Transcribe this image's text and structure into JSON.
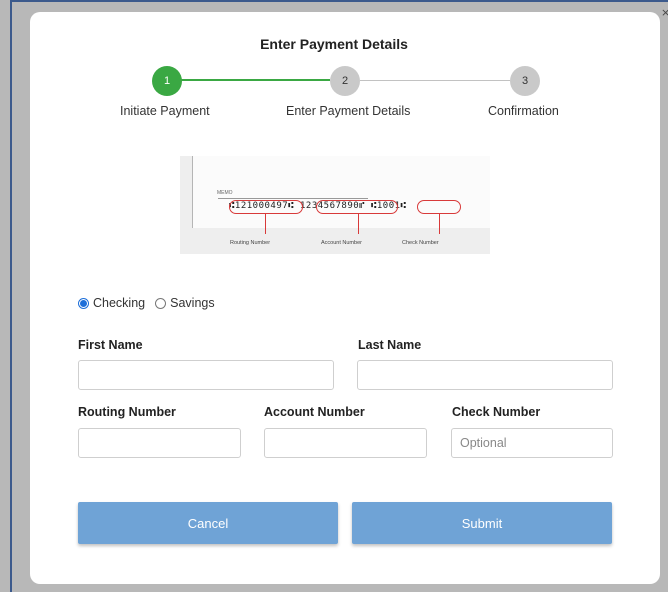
{
  "stepper": {
    "title": "Enter Payment Details",
    "steps": [
      {
        "number": "1",
        "label": "Initiate Payment",
        "state": "complete"
      },
      {
        "number": "2",
        "label": "Enter Payment Details",
        "state": "current"
      },
      {
        "number": "3",
        "label": "Confirmation",
        "state": "pending"
      }
    ],
    "accent_color": "#3aa843"
  },
  "check_image": {
    "memo": "MEMO",
    "micr_line": "⑆121000497⑆ 1234567890⑈ ⑆1001⑆",
    "routing_label": "Routing Number",
    "account_label": "Account Number",
    "check_label": "Check Number"
  },
  "account_type": {
    "options": [
      "Checking",
      "Savings"
    ],
    "selected": "Checking"
  },
  "form": {
    "first_name": {
      "label": "First Name",
      "value": "",
      "placeholder": ""
    },
    "last_name": {
      "label": "Last Name",
      "value": "",
      "placeholder": ""
    },
    "routing_number": {
      "label": "Routing Number",
      "value": "",
      "placeholder": ""
    },
    "account_number": {
      "label": "Account Number",
      "value": "",
      "placeholder": ""
    },
    "check_number": {
      "label": "Check Number",
      "value": "",
      "placeholder": "Optional"
    }
  },
  "buttons": {
    "cancel": "Cancel",
    "submit": "Submit",
    "color": "#6fa3d6"
  }
}
